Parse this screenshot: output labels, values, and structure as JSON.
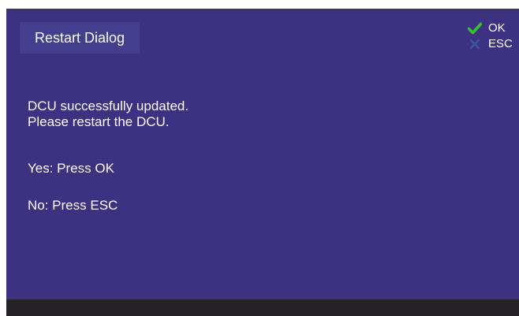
{
  "dialog": {
    "title": "Restart Dialog",
    "message_line1": "DCU successfully updated.",
    "message_line2": "Please restart the DCU.",
    "yes_text": "Yes: Press OK",
    "no_text": "No: Press ESC"
  },
  "keys": {
    "ok": {
      "label": "OK",
      "icon": "checkmark-icon",
      "color": "#35c22f"
    },
    "esc": {
      "label": "ESC",
      "icon": "x-icon",
      "color": "#3a55a8"
    }
  },
  "colors": {
    "background": "#3d3182",
    "title_box": "#443e8f",
    "bottom_bar": "#262228",
    "text": "#ffffff"
  }
}
